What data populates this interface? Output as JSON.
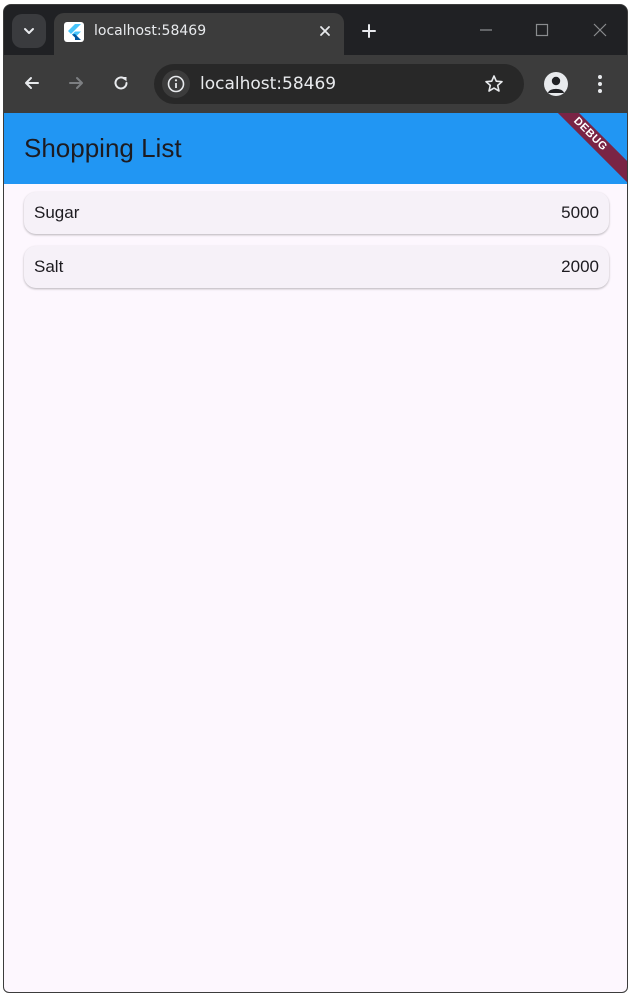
{
  "browser": {
    "tab_title": "localhost:58469",
    "url": "localhost:58469"
  },
  "app": {
    "title": "Shopping List",
    "debug_banner": "DEBUG",
    "colors": {
      "appbar": "#2196f3",
      "background": "#fdf7fe",
      "card": "#f6f1f8",
      "debug": "#7a2445"
    },
    "items": [
      {
        "name": "Sugar",
        "quantity": "5000"
      },
      {
        "name": "Salt",
        "quantity": "2000"
      }
    ]
  }
}
